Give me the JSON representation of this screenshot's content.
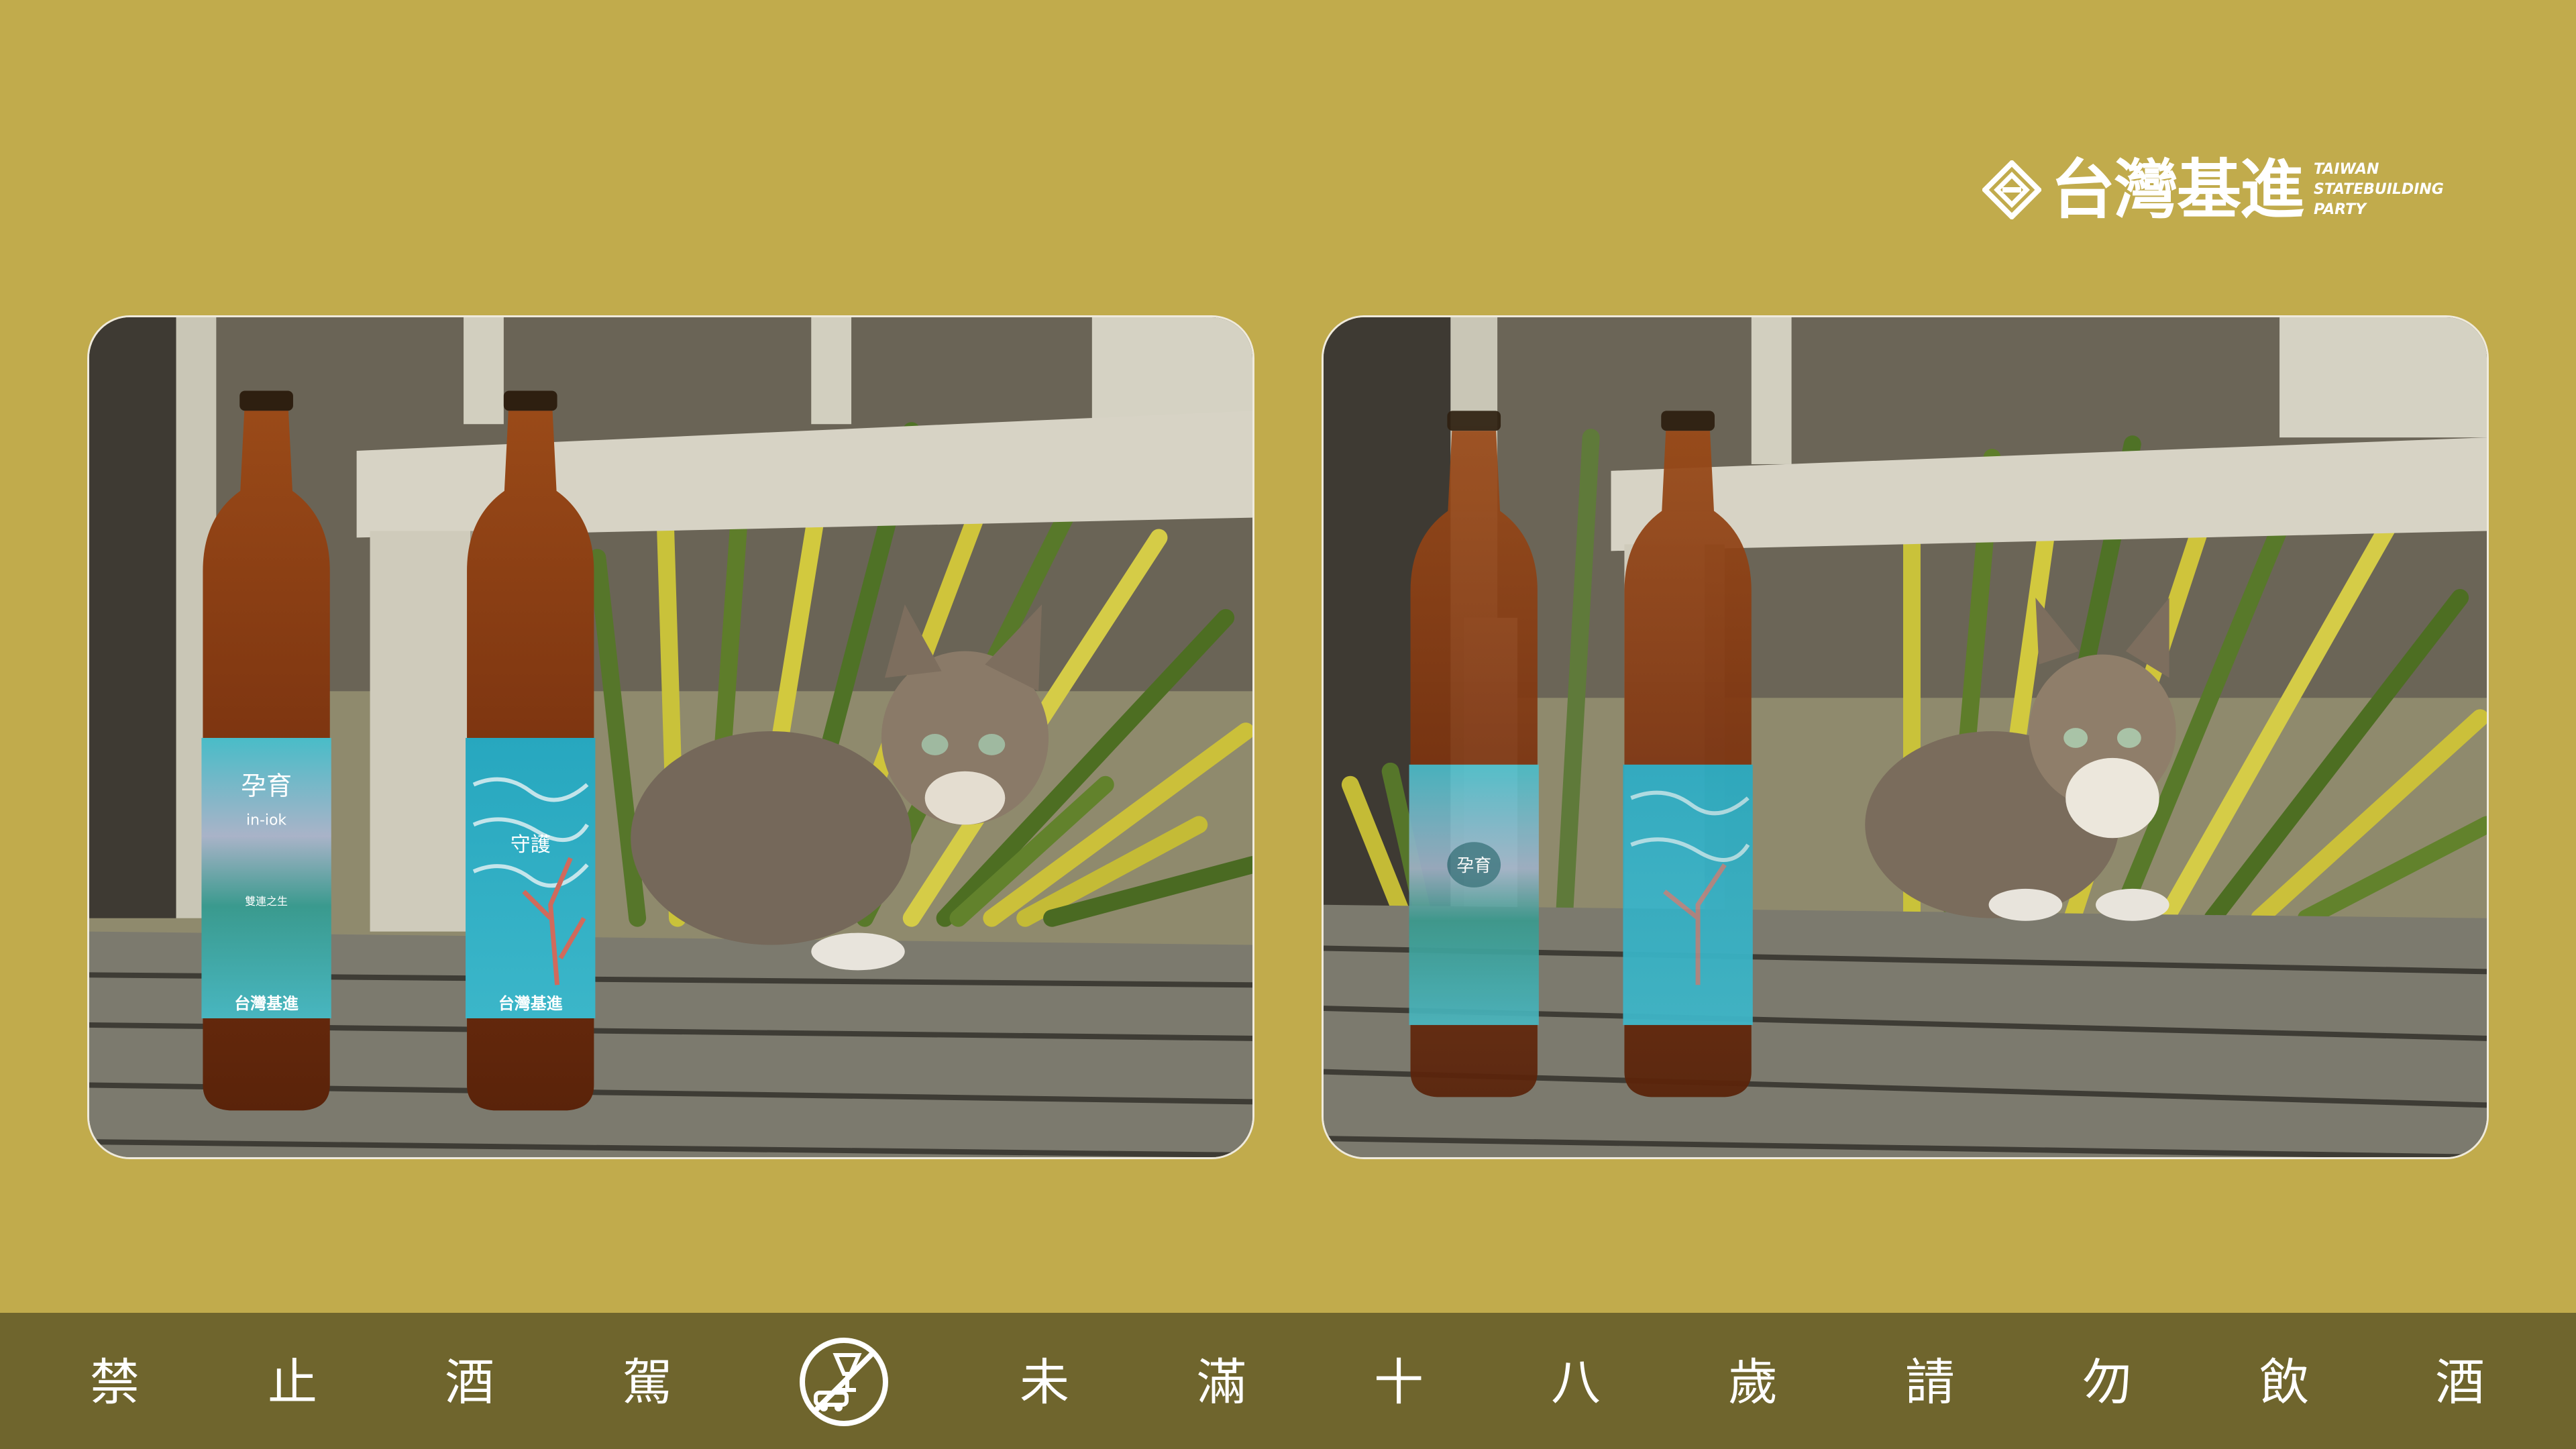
{
  "header": {
    "logo_name": "台灣基進",
    "logo_en": [
      "TAIWAN",
      "STATEBUILDING",
      "PARTY"
    ]
  },
  "photos": [
    {
      "bottles": [
        {
          "label_title": "孕育",
          "label_subtitle": "in-iok",
          "label_caption": "雙連之生",
          "label_brand": "台灣基進"
        },
        {
          "label_title": "守護",
          "label_brand": "台灣基進"
        }
      ]
    },
    {
      "bottles": [
        {
          "label_title": "孕育"
        },
        {}
      ]
    }
  ],
  "footer": {
    "warning_chars": [
      "禁",
      "止",
      "酒",
      "駕",
      "未",
      "滿",
      "十",
      "八",
      "歲",
      "請",
      "勿",
      "飲",
      "酒"
    ],
    "icon": "no-drunk-driving-icon"
  },
  "colors": {
    "background": "#c1ab4c",
    "footer_bar": "#6f652d",
    "label_teal": "#3fb3c3"
  }
}
